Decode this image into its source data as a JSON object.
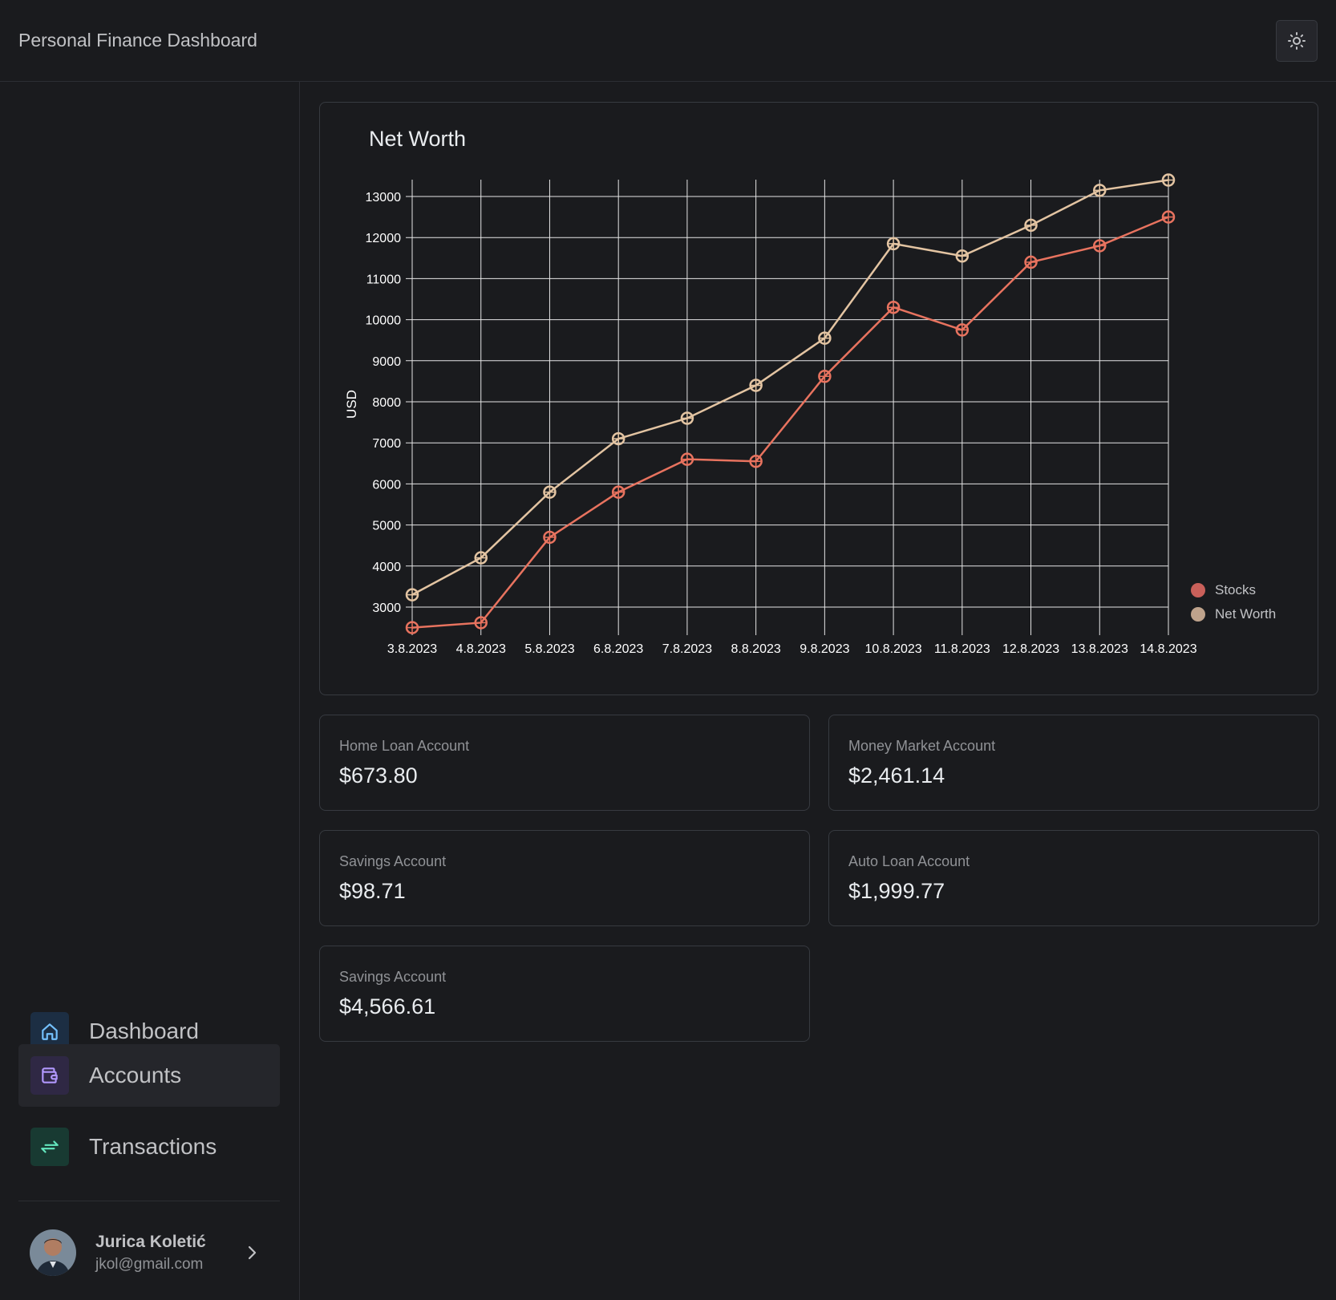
{
  "header": {
    "title": "Personal Finance Dashboard",
    "theme_toggle_icon": "sun-icon"
  },
  "sidebar": {
    "items": [
      {
        "label": "Dashboard",
        "icon": "home-icon",
        "icon_bg": "#1c2e43",
        "icon_color": "#74c0fc",
        "active": false
      },
      {
        "label": "Accounts",
        "icon": "wallet-icon",
        "icon_bg": "#2f2844",
        "icon_color": "#b197fc",
        "active": true
      },
      {
        "label": "Transactions",
        "icon": "arrows-exchange-icon",
        "icon_bg": "#183a32",
        "icon_color": "#63e6be",
        "active": false
      }
    ],
    "user": {
      "name": "Jurica Koletić",
      "email": "jkol@gmail.com"
    }
  },
  "chart": {
    "title": "Net Worth"
  },
  "chart_data": {
    "type": "line",
    "title": "Net Worth",
    "xlabel": "",
    "ylabel": "USD",
    "x": [
      "3.8.2023",
      "4.8.2023",
      "5.8.2023",
      "6.8.2023",
      "7.8.2023",
      "8.8.2023",
      "9.8.2023",
      "10.8.2023",
      "11.8.2023",
      "12.8.2023",
      "13.8.2023",
      "14.8.2023"
    ],
    "yticks": [
      3000,
      4000,
      5000,
      6000,
      7000,
      8000,
      9000,
      10000,
      11000,
      12000,
      13000
    ],
    "series": [
      {
        "name": "Stocks",
        "color": "#e8735f",
        "values": [
          2500,
          2620,
          4700,
          5800,
          6600,
          6550,
          8620,
          10300,
          9750,
          11400,
          11800,
          12500
        ]
      },
      {
        "name": "Net Worth",
        "color": "#e3c4a2",
        "values": [
          3300,
          4200,
          5800,
          7100,
          7600,
          8400,
          9550,
          11850,
          11550,
          12300,
          13150,
          13400
        ]
      }
    ],
    "legend_colors": [
      "#c9605a",
      "#bfa38c"
    ],
    "legend_position": "bottom-right",
    "grid": true
  },
  "accounts": [
    {
      "name": "Home Loan Account",
      "balance": "$673.80"
    },
    {
      "name": "Money Market Account",
      "balance": "$2,461.14"
    },
    {
      "name": "Savings Account",
      "balance": "$98.71"
    },
    {
      "name": "Auto Loan Account",
      "balance": "$1,999.77"
    },
    {
      "name": "Savings Account",
      "balance": "$4,566.61"
    }
  ]
}
